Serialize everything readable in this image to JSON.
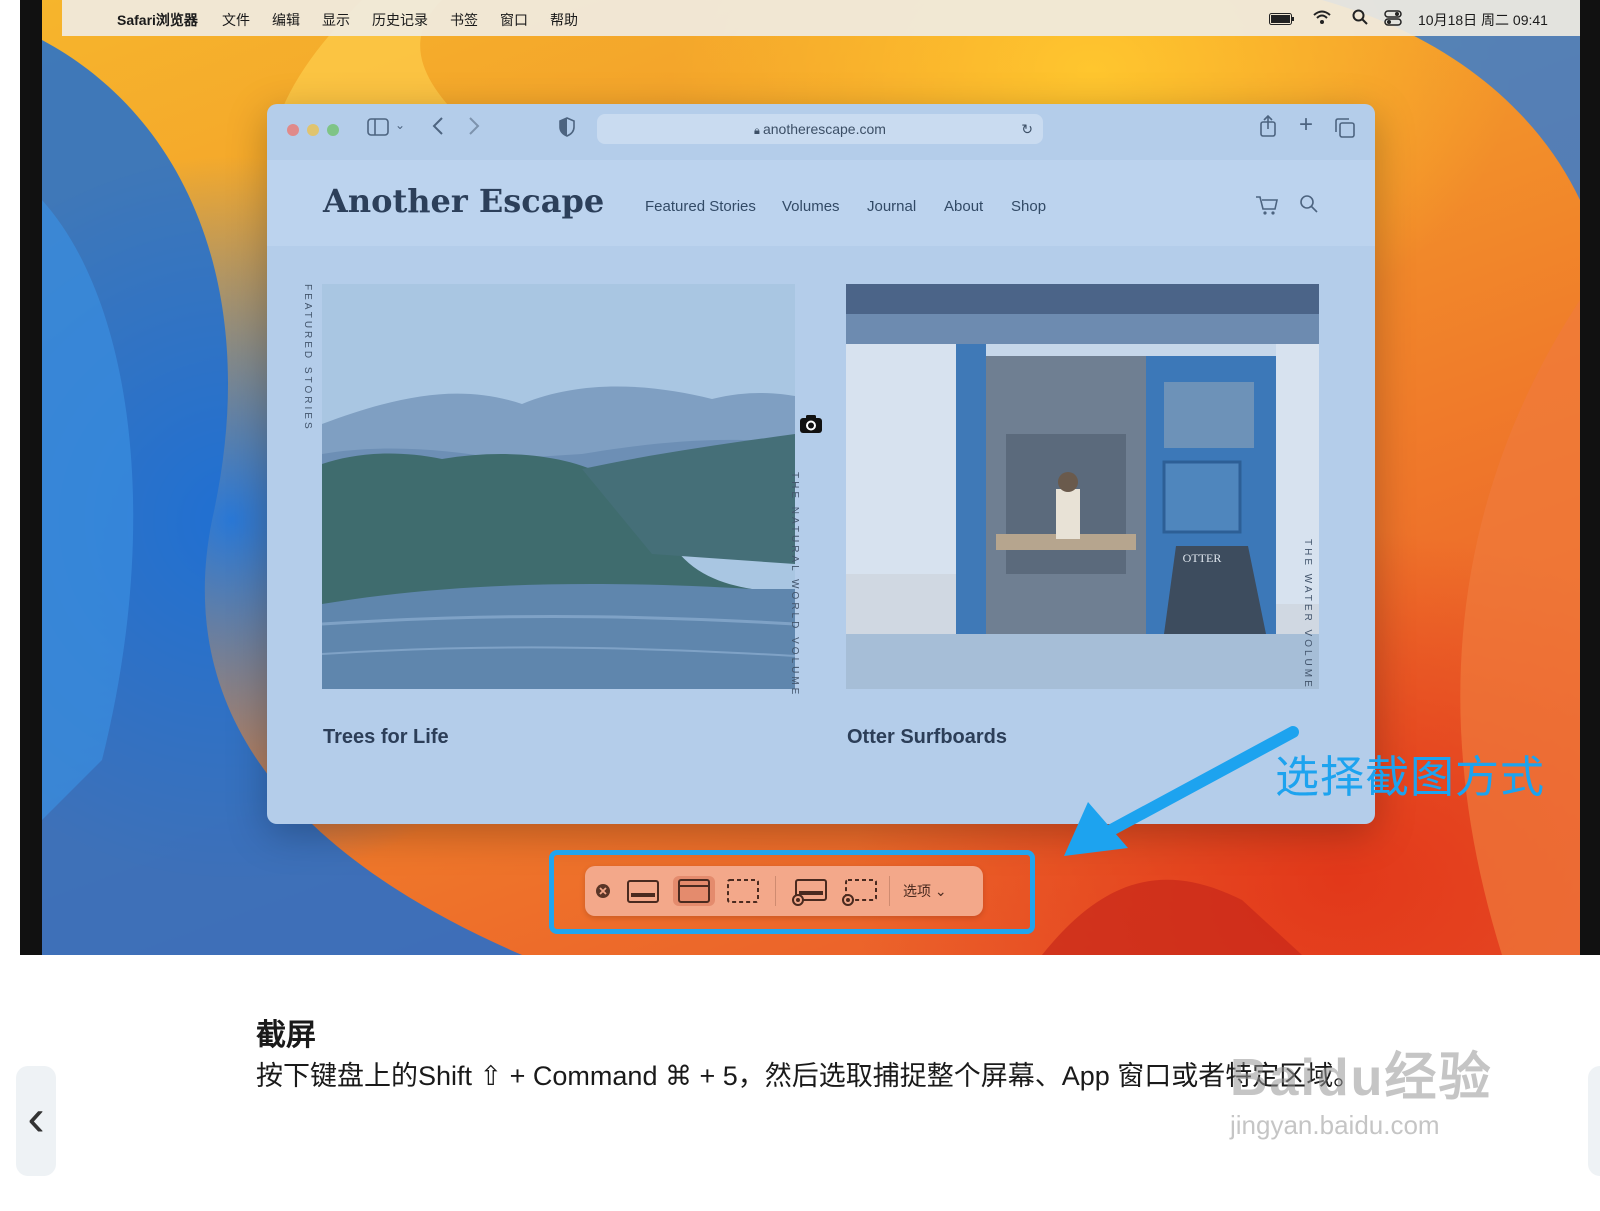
{
  "menubar": {
    "apple": "",
    "app_name": "Safari浏览器",
    "items": [
      "文件",
      "编辑",
      "显示",
      "历史记录",
      "书签",
      "窗口",
      "帮助"
    ],
    "datetime": "10月18日 周二 09:41"
  },
  "browser": {
    "url": "anotherescape.com",
    "site": {
      "logo": "Another Escape",
      "nav": [
        "Featured Stories",
        "Volumes",
        "Journal",
        "About",
        "Shop"
      ],
      "side_label_left": "FEATURED STORIES",
      "side_label_middle": "THE NATURAL WORLD VOLUME",
      "side_label_right": "THE WATER VOLUME",
      "stories": [
        {
          "title": "Trees for Life"
        },
        {
          "title": "Otter Surfboards",
          "sign": "OTTER"
        }
      ]
    }
  },
  "screenshot_toolbar": {
    "options_label": "选项"
  },
  "annotation": {
    "text": "选择截图方式",
    "color": "#1da3ef"
  },
  "caption": {
    "heading": "截屏",
    "body": "按下键盘上的Shift ⇧ + Command ⌘ + 5，然后选取捕捉整个屏幕、App 窗口或者特定区域。"
  },
  "watermark": {
    "line1": "Baidu经验",
    "line2": "jingyan.baidu.com"
  }
}
